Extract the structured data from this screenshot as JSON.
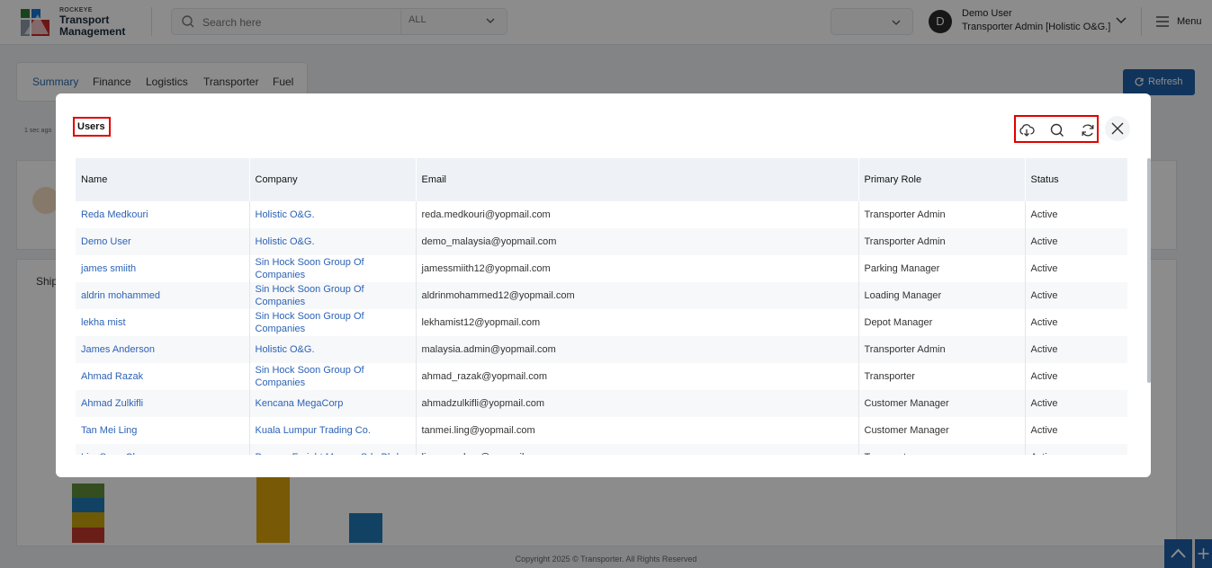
{
  "app": {
    "logo_small": "ROCKEYE",
    "logo_title": "Transport Management"
  },
  "search": {
    "placeholder": "Search here",
    "filter_value": "ALL"
  },
  "user": {
    "initial": "D",
    "name": "Demo User",
    "role": "Transporter Admin [Holistic O&G.]"
  },
  "menu": {
    "label": "Menu"
  },
  "tabs": [
    {
      "label": "Summary"
    },
    {
      "label": "Finance"
    },
    {
      "label": "Logistics"
    },
    {
      "label": "Transporter"
    },
    {
      "label": "Fuel"
    }
  ],
  "refresh": {
    "label": "Refresh"
  },
  "background": {
    "timestamp": "1 sec ago",
    "section_label": "Ship"
  },
  "footer": {
    "copyright": "Copyright 2025 © Transporter. All Rights Reserved"
  },
  "modal": {
    "title": "Users",
    "columns": [
      "Name",
      "Company",
      "Email",
      "Primary Role",
      "Status"
    ],
    "rows": [
      {
        "name": "Reda Medkouri",
        "company": "Holistic O&G.",
        "email": "reda.medkouri@yopmail.com",
        "role": "Transporter Admin",
        "status": "Active"
      },
      {
        "name": "Demo User",
        "company": "Holistic O&G.",
        "email": "demo_malaysia@yopmail.com",
        "role": "Transporter Admin",
        "status": "Active"
      },
      {
        "name": "james smiith",
        "company": "Sin Hock Soon Group Of Companies",
        "email": "jamessmiith12@yopmail.com",
        "role": "Parking Manager",
        "status": "Active"
      },
      {
        "name": "aldrin mohammed",
        "company": "Sin Hock Soon Group Of Companies",
        "email": "aldrinmohammed12@yopmail.com",
        "role": "Loading Manager",
        "status": "Active"
      },
      {
        "name": "lekha mist",
        "company": "Sin Hock Soon Group Of Companies",
        "email": "lekhamist12@yopmail.com",
        "role": "Depot Manager",
        "status": "Active"
      },
      {
        "name": "James Anderson",
        "company": "Holistic O&G.",
        "email": "malaysia.admin@yopmail.com",
        "role": "Transporter Admin",
        "status": "Active"
      },
      {
        "name": "Ahmad Razak",
        "company": "Sin Hock Soon Group Of Companies",
        "email": "ahmad_razak@yopmail.com",
        "role": "Transporter",
        "status": "Active"
      },
      {
        "name": "Ahmad Zulkifli",
        "company": "Kencana MegaCorp",
        "email": "ahmadzulkifli@yopmail.com",
        "role": "Customer Manager",
        "status": "Active"
      },
      {
        "name": "Tan Mei Ling",
        "company": "Kuala Lumpur Trading Co.",
        "email": "tanmei.ling@yopmail.com",
        "role": "Customer Manager",
        "status": "Active"
      },
      {
        "name": "Lim Seng Chee",
        "company": "Penang Freight Movers Sdn Bhd",
        "email": "lim.sengchee@yopmail.com",
        "role": "Transporter",
        "status": "Active"
      }
    ]
  },
  "icons": {
    "download": "cloud-download-icon",
    "search": "search-icon",
    "refresh": "refresh-icon",
    "close": "close-icon"
  },
  "colors": {
    "accent": "#1f5fa8",
    "link": "#2c63b5",
    "highlight": "#e00000"
  }
}
